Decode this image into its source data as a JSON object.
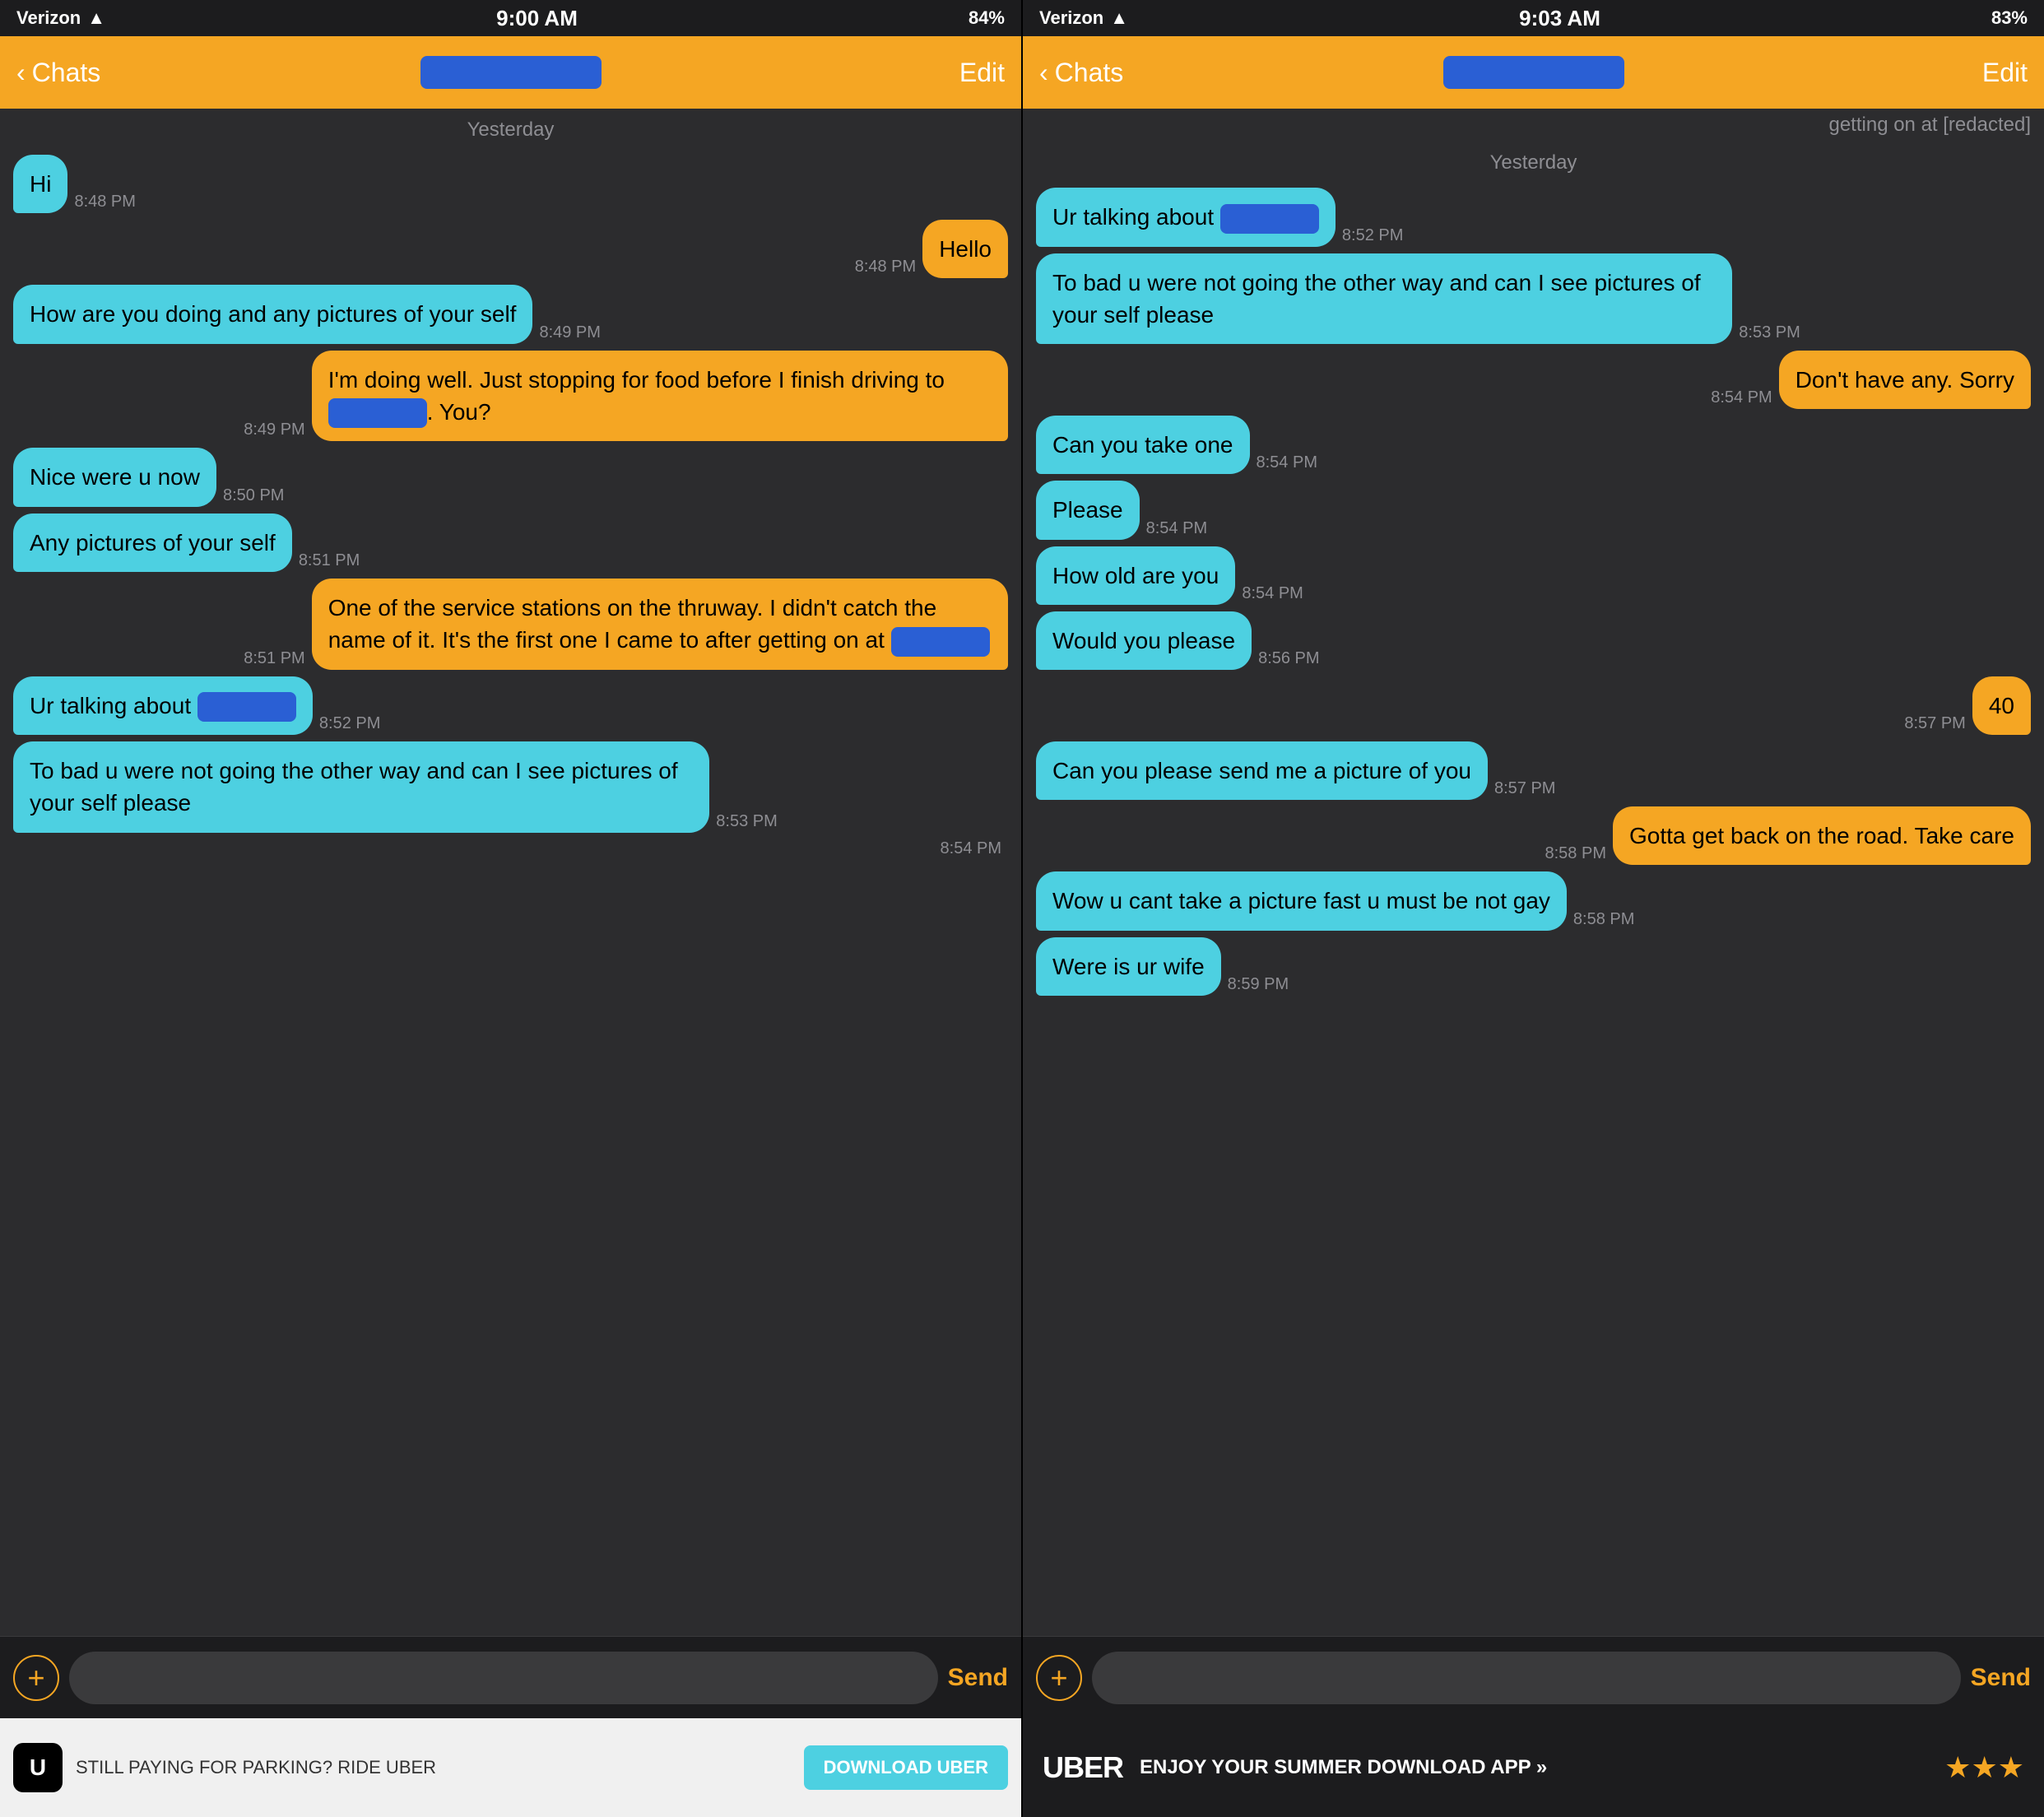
{
  "screen1": {
    "status": {
      "carrier": "Verizon",
      "signal": "●●○○○",
      "wifi": "▲",
      "time": "9:00 AM",
      "gps": "▲",
      "alarm": "⏰",
      "bluetooth": "✦",
      "battery": "84%"
    },
    "nav": {
      "back": "Chats",
      "edit": "Edit"
    },
    "date_label": "Yesterday",
    "messages": [
      {
        "id": "m1",
        "side": "left",
        "text": "Hi",
        "time": "8:48 PM",
        "bubble": "cyan"
      },
      {
        "id": "m2",
        "side": "right",
        "text": "Hello",
        "time": "8:48 PM",
        "bubble": "yellow"
      },
      {
        "id": "m3",
        "side": "left",
        "text": "How are you doing and any pictures of your self",
        "time": "8:49 PM",
        "bubble": "cyan"
      },
      {
        "id": "m4",
        "side": "right",
        "text": "I'm doing well. Just stopping for food before I finish driving to [redacted]. You?",
        "time": "8:49 PM",
        "bubble": "yellow"
      },
      {
        "id": "m5",
        "side": "left",
        "text": "Nice were u now",
        "time": "8:50 PM",
        "bubble": "cyan"
      },
      {
        "id": "m6",
        "side": "left",
        "text": "Any pictures of your self",
        "time": "8:51 PM",
        "bubble": "cyan"
      },
      {
        "id": "m7",
        "side": "right",
        "text": "One of the service stations on the thruway. I didn't catch the name of it. It's the first one I came to after getting on at [redacted]",
        "time": "8:51 PM",
        "bubble": "yellow"
      },
      {
        "id": "m8",
        "side": "left",
        "text": "Ur talking about [redacted]",
        "time": "8:52 PM",
        "bubble": "cyan"
      },
      {
        "id": "m9",
        "side": "left",
        "text": "To bad u were not going the other way and can I see pictures of your self please",
        "time": "8:53 PM",
        "bubble": "cyan"
      }
    ],
    "bottom": {
      "plus": "+",
      "placeholder": "",
      "send": "Send"
    },
    "ad": {
      "logo": "U",
      "text": "STILL PAYING FOR PARKING? RIDE UBER",
      "download": "DOWNLOAD UBER"
    }
  },
  "screen2": {
    "status": {
      "carrier": "Verizon",
      "signal": "●●○○○",
      "wifi": "▲",
      "time": "9:03 AM",
      "gps": "▲",
      "alarm": "⏰",
      "bluetooth": "✦",
      "battery": "83%"
    },
    "nav": {
      "back": "Chats",
      "edit": "Edit"
    },
    "date_label": "Yesterday",
    "messages": [
      {
        "id": "s1",
        "side": "left",
        "text": "Ur talking about [redacted]",
        "time": "8:52 PM",
        "bubble": "cyan"
      },
      {
        "id": "s2",
        "side": "left",
        "text": "To bad u were not going the other way and can I see pictures of your self please",
        "time": "8:53 PM",
        "bubble": "cyan"
      },
      {
        "id": "s3",
        "side": "right",
        "text": "Don't have any. Sorry",
        "time": "8:54 PM",
        "bubble": "yellow"
      },
      {
        "id": "s4",
        "side": "left",
        "text": "Can you take one",
        "time": "8:54 PM",
        "bubble": "cyan"
      },
      {
        "id": "s5",
        "side": "left",
        "text": "Please",
        "time": "8:54 PM",
        "bubble": "cyan"
      },
      {
        "id": "s6",
        "side": "left",
        "text": "How old are you",
        "time": "8:54 PM",
        "bubble": "cyan"
      },
      {
        "id": "s7",
        "side": "left",
        "text": "Would you please",
        "time": "8:56 PM",
        "bubble": "cyan"
      },
      {
        "id": "s8",
        "side": "right",
        "text": "40",
        "time": "8:57 PM",
        "bubble": "yellow"
      },
      {
        "id": "s9",
        "side": "left",
        "text": "Can you please send me a picture of you",
        "time": "8:57 PM",
        "bubble": "cyan"
      },
      {
        "id": "s10",
        "side": "right",
        "text": "Gotta get back on the road. Take care",
        "time": "8:58 PM",
        "bubble": "yellow"
      },
      {
        "id": "s11",
        "side": "left",
        "text": "Wow u cant take a picture fast u must be not gay",
        "time": "8:58 PM",
        "bubble": "cyan"
      },
      {
        "id": "s12",
        "side": "left",
        "text": "Were is ur wife",
        "time": "8:59 PM",
        "bubble": "cyan"
      }
    ],
    "bottom": {
      "plus": "+",
      "placeholder": "",
      "send": "Send"
    },
    "ad": {
      "logo": "UBER",
      "text": "ENJOY YOUR SUMMER DOWNLOAD APP »",
      "stars": "★★★"
    }
  }
}
